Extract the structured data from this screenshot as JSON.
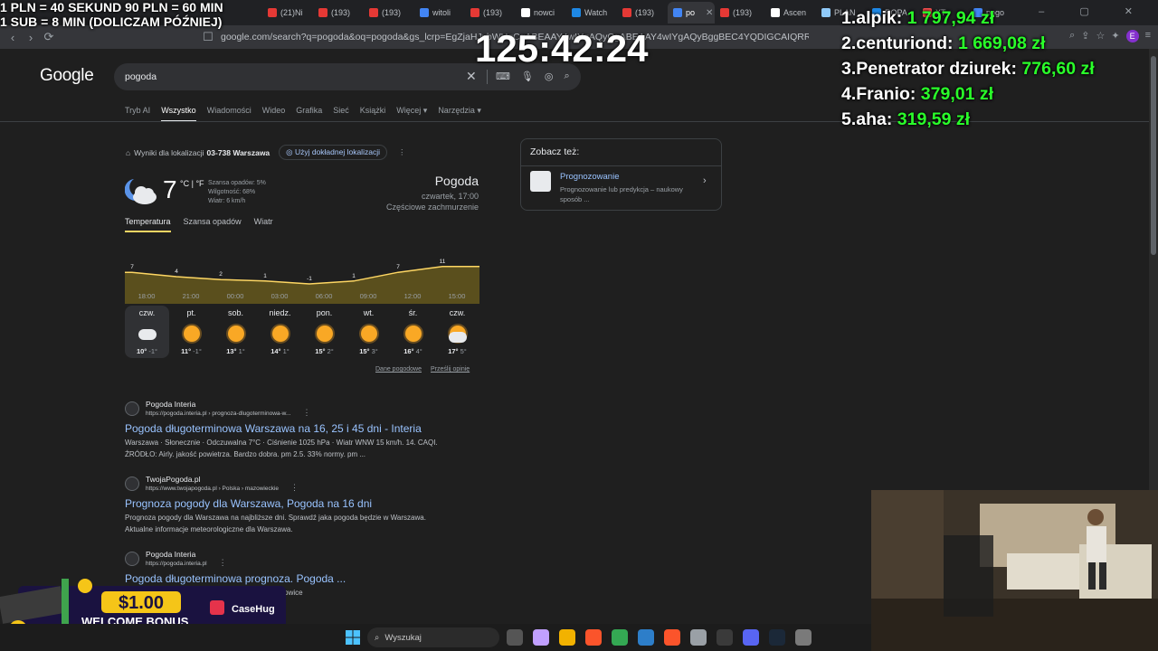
{
  "browser": {
    "tabs": [
      {
        "label": "(21)Ni",
        "color": "#e53935"
      },
      {
        "label": "(193)",
        "color": "#e53935"
      },
      {
        "label": "(193)",
        "color": "#e53935"
      },
      {
        "label": "witoli",
        "color": "#4285f4"
      },
      {
        "label": "(193)",
        "color": "#e53935"
      },
      {
        "label": "nowci",
        "color": "#ffffff"
      },
      {
        "label": "Watch",
        "color": "#1e88e5"
      },
      {
        "label": "(193)",
        "color": "#e53935"
      },
      {
        "label": "po",
        "color": "#4285f4",
        "active": true
      },
      {
        "label": "(193)",
        "color": "#e53935"
      },
      {
        "label": "Ascen",
        "color": "#ffffff"
      },
      {
        "label": "PLAN",
        "color": "#90caf9"
      },
      {
        "label": "ROPA",
        "color": "#1e88e5"
      },
      {
        "label": "XT",
        "color": "#ff5252"
      },
      {
        "label": "pogo",
        "color": "#4285f4"
      }
    ],
    "url": "google.com/search?q=pogoda&oq=pogoda&gs_lcrp=EgZjaHJvbWUqCgABEAAY4wIYgAQyCgABEAAY4wIYgAQyBggBEC4YQDIGCAIQRRg8MgYIAxBFGDsyBggCEEUYOzIGCAMQRRg8Mg...",
    "profile_letter": "E"
  },
  "search": {
    "logo": "Google",
    "query": "pogoda",
    "tabs": [
      "Tryb AI",
      "Wszystko",
      "Wiadomości",
      "Wideo",
      "Grafika",
      "Sieć",
      "Książki",
      "Więcej ▾",
      "Narzędzia ▾"
    ]
  },
  "location": {
    "prefix": "Wyniki dla lokalizacji",
    "place": "03-738 Warszawa",
    "button": "Użyj dokładnej lokalizacji"
  },
  "weather": {
    "temp": "7",
    "unit": "°C | °F",
    "precip": "Szansa opadów: 5%",
    "humidity": "Wilgotność: 68%",
    "wind": "Wiatr: 6 km/h",
    "title": "Pogoda",
    "datetime": "czwartek, 17:00",
    "condition": "Częściowe zachmurzenie",
    "tabs": [
      "Temperatura",
      "Szansa opadów",
      "Wiatr"
    ],
    "footer_links": [
      "Dane pogodowe",
      "Prześlij opinię"
    ],
    "hourly": [
      {
        "time": "18:00",
        "temp": 7
      },
      {
        "time": "21:00",
        "temp": 4
      },
      {
        "time": "00:00",
        "temp": 2
      },
      {
        "time": "03:00",
        "temp": 1
      },
      {
        "time": "06:00",
        "temp": -1
      },
      {
        "time": "09:00",
        "temp": 1
      },
      {
        "time": "12:00",
        "temp": 7
      },
      {
        "time": "15:00",
        "temp": 11
      }
    ],
    "hourly_extra_end_temp": 11,
    "days": [
      {
        "name": "czw.",
        "icon": "cloud-icon",
        "hi": "10°",
        "lo": "-1°",
        "active": true
      },
      {
        "name": "pt.",
        "icon": "sun-icon",
        "hi": "11°",
        "lo": "-1°"
      },
      {
        "name": "sob.",
        "icon": "sun-icon",
        "hi": "13°",
        "lo": "1°"
      },
      {
        "name": "niedz.",
        "icon": "sun-icon",
        "hi": "14°",
        "lo": "1°"
      },
      {
        "name": "pon.",
        "icon": "sun-icon",
        "hi": "15°",
        "lo": "2°"
      },
      {
        "name": "wt.",
        "icon": "sun-icon",
        "hi": "15°",
        "lo": "3°"
      },
      {
        "name": "śr.",
        "icon": "sun-icon",
        "hi": "16°",
        "lo": "4°"
      },
      {
        "name": "czw.",
        "icon": "partly-cloudy-icon",
        "hi": "17°",
        "lo": "5°"
      }
    ],
    "colors": {
      "line": "#fdd663",
      "fill": "#5a4f1d"
    }
  },
  "see_also": {
    "title": "Zobacz też:",
    "name": "Prognozowanie",
    "desc": "Prognozowanie lub predykcja – naukowy sposób ..."
  },
  "results": [
    {
      "site": "Pogoda Interia",
      "url": "https://pogoda.interia.pl › prognoza-dlugoterminowa-w...",
      "title": "Pogoda długoterminowa Warszawa na 16, 25 i 45 dni - Interia",
      "snippet1": "Warszawa · Słonecznie · Odczuwalna 7°C · Ciśnienie 1025 hPa · Wiatr WNW 15 km/h. 14. CAQI.",
      "snippet2": "ŹRÓDŁO: Airly. jakość powietrza. Bardzo dobra. pm 2.5. 33% normy. pm ..."
    },
    {
      "site": "TwojaPogoda.pl",
      "url": "https://www.twojapogoda.pl › Polska › mazowieckie",
      "title": "Prognoza pogody dla Warszawa, Pogoda na 16 dni",
      "snippet1": "Prognoza pogody dla Warszawa na najbliższe dni. Sprawdź jaka pogoda będzie w Warszawa.",
      "snippet2": "Aktualne informacje meteorologiczne dla Warszawa."
    },
    {
      "site": "Pogoda Interia",
      "url": "https://pogoda.interia.pl",
      "title": "Pogoda długoterminowa prognoza. Pogoda ...",
      "snippet1": "ydgoszcz 11°C · Kraków 12°C · Gdańsk 8°C · Katowice",
      "snippet2": ""
    }
  ],
  "overlay": {
    "rule1": "1 PLN =  40 SEKUND 90 PLN = 60 MIN",
    "rule2": "1 SUB = 8 MIN (DOLICZAM PÓŹNIEJ)",
    "timer": "125:42:24",
    "leaderboard": [
      {
        "rank": "1.",
        "name": "alpik:",
        "amount": "1 797,94 zł"
      },
      {
        "rank": "2.",
        "name": "centuriond:",
        "amount": "1 669,08 zł"
      },
      {
        "rank": "3.",
        "name": "Penetrator dziurek:",
        "amount": "776,60 zł"
      },
      {
        "rank": "4.",
        "name": "Franio:",
        "amount": "379,01 zł"
      },
      {
        "rank": "5.",
        "name": "aha:",
        "amount": "319,59 zł"
      }
    ],
    "promo_amount": "$1.00",
    "promo_text": "WELCOME BONUS",
    "promo_brand": "CaseHug"
  },
  "taskbar": {
    "search_placeholder": "Wyszukaj",
    "apps": [
      "#555555",
      "#c1a0ff",
      "#f2b200",
      "#fb542b",
      "#34a853",
      "#2d7ec9",
      "#fb542b",
      "#9aa0a6",
      "#3a3a3a",
      "#5865f2",
      "#1b2838",
      "#7a7a7a"
    ]
  }
}
